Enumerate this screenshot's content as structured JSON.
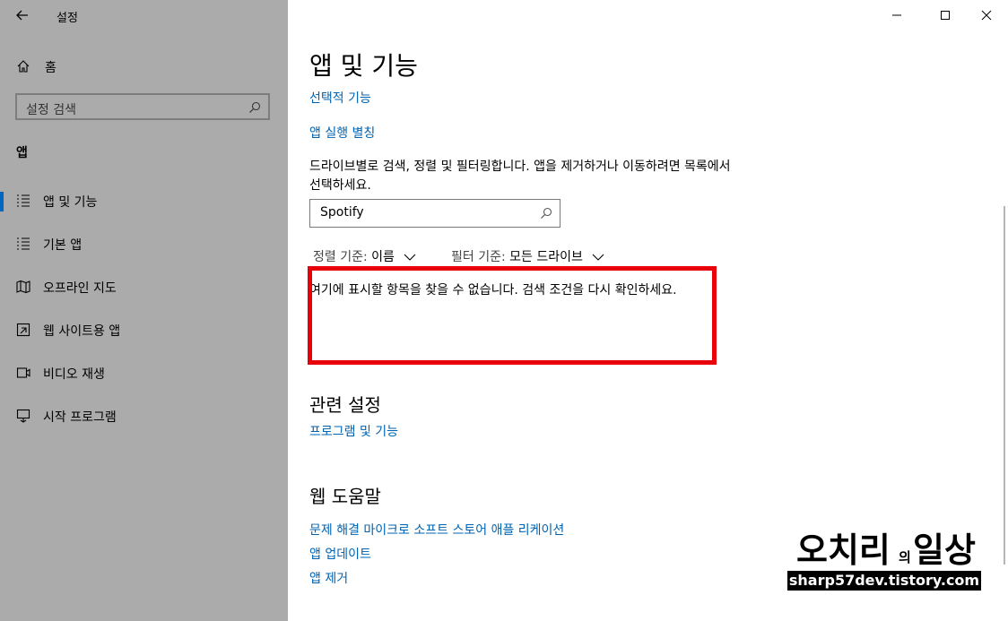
{
  "window": {
    "title": "설정"
  },
  "sidebar": {
    "home_label": "홈",
    "search_placeholder": "설정 검색",
    "section_title": "앱",
    "items": [
      {
        "label": "앱 및 기능",
        "icon": "apps-features-icon",
        "selected": true
      },
      {
        "label": "기본 앱",
        "icon": "default-apps-icon",
        "selected": false
      },
      {
        "label": "오프라인 지도",
        "icon": "offline-maps-icon",
        "selected": false
      },
      {
        "label": "웹 사이트용 앱",
        "icon": "apps-for-websites-icon",
        "selected": false
      },
      {
        "label": "비디오 재생",
        "icon": "video-playback-icon",
        "selected": false
      },
      {
        "label": "시작 프로그램",
        "icon": "startup-icon",
        "selected": false
      }
    ]
  },
  "main": {
    "title": "앱 및 기능",
    "link_optional_features": "선택적 기능",
    "link_app_aliases": "앱 실행 별칭",
    "description": "드라이브별로 검색, 정렬 및 필터링합니다. 앱을 제거하거나 이동하려면 목록에서 선택하세요.",
    "search_value": "Spotify",
    "sort_label": "정렬 기준:",
    "sort_value": "이름",
    "filter_label": "필터 기준:",
    "filter_value": "모든 드라이브",
    "empty_message": "여기에 표시할 항목을 찾을 수 없습니다. 검색 조건을 다시 확인하세요.",
    "related_title": "관련 설정",
    "related_link": "프로그램 및 기능",
    "help_title": "웹 도움말",
    "help_links": [
      "문제 해결 마이크로 소프트 스토어 애플 리케이션",
      "앱 업데이트",
      "앱 제거"
    ]
  },
  "watermark": {
    "title": "오치리의일상",
    "url": "sharp57dev.tistory.com"
  },
  "colors": {
    "sidebar_bg": "#ababab",
    "link": "#0063b1",
    "highlight": "#e8000b",
    "accent": "#0067c0"
  }
}
